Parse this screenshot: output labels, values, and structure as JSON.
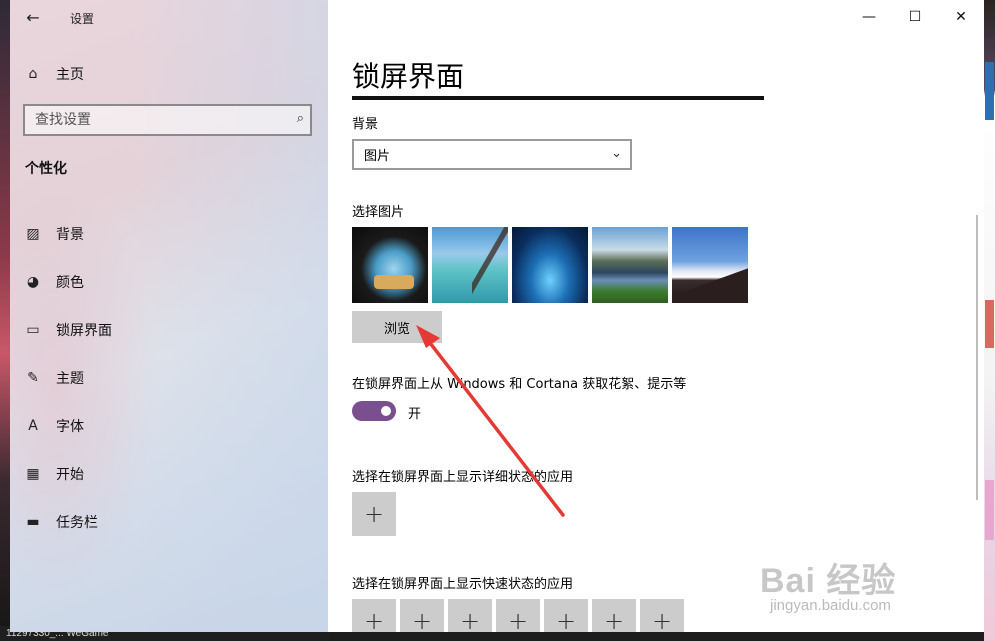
{
  "window": {
    "app_title": "设置",
    "back_icon": "←",
    "minimize_icon": "—",
    "maximize_icon": "☐",
    "close_icon": "✕"
  },
  "sidebar": {
    "home": {
      "icon": "⌂",
      "label": "主页"
    },
    "search": {
      "placeholder": "查找设置",
      "icon": "⌕"
    },
    "section_heading": "个性化",
    "items": [
      {
        "icon": "▨",
        "label": "背景"
      },
      {
        "icon": "◕",
        "label": "颜色"
      },
      {
        "icon": "▭",
        "label": "锁屏界面"
      },
      {
        "icon": "✎",
        "label": "主题"
      },
      {
        "icon": "A",
        "label": "字体"
      },
      {
        "icon": "▦",
        "label": "开始"
      },
      {
        "icon": "▬",
        "label": "任务栏"
      }
    ]
  },
  "content": {
    "page_title": "锁屏界面",
    "background_label": "背景",
    "background_value": "图片",
    "dropdown_icon": "⌄",
    "choose_picture_label": "选择图片",
    "browse_button": "浏览",
    "spotlight_label": "在锁屏界面上从 Windows 和 Cortana 获取花絮、提示等",
    "toggle_state": "开",
    "toggle_on": true,
    "detailed_status_label": "选择在锁屏界面上显示详细状态的应用",
    "quick_status_label": "选择在锁屏界面上显示快速状态的应用",
    "add_icon": "+",
    "accent_color": "#7a4f8f"
  },
  "taskbar": {
    "text": "11297330_...    WeGame"
  },
  "watermark": {
    "brand": "Bai 经验",
    "sub": "jingyan.baidu.com"
  },
  "annotation": {
    "color": "#e53935"
  }
}
